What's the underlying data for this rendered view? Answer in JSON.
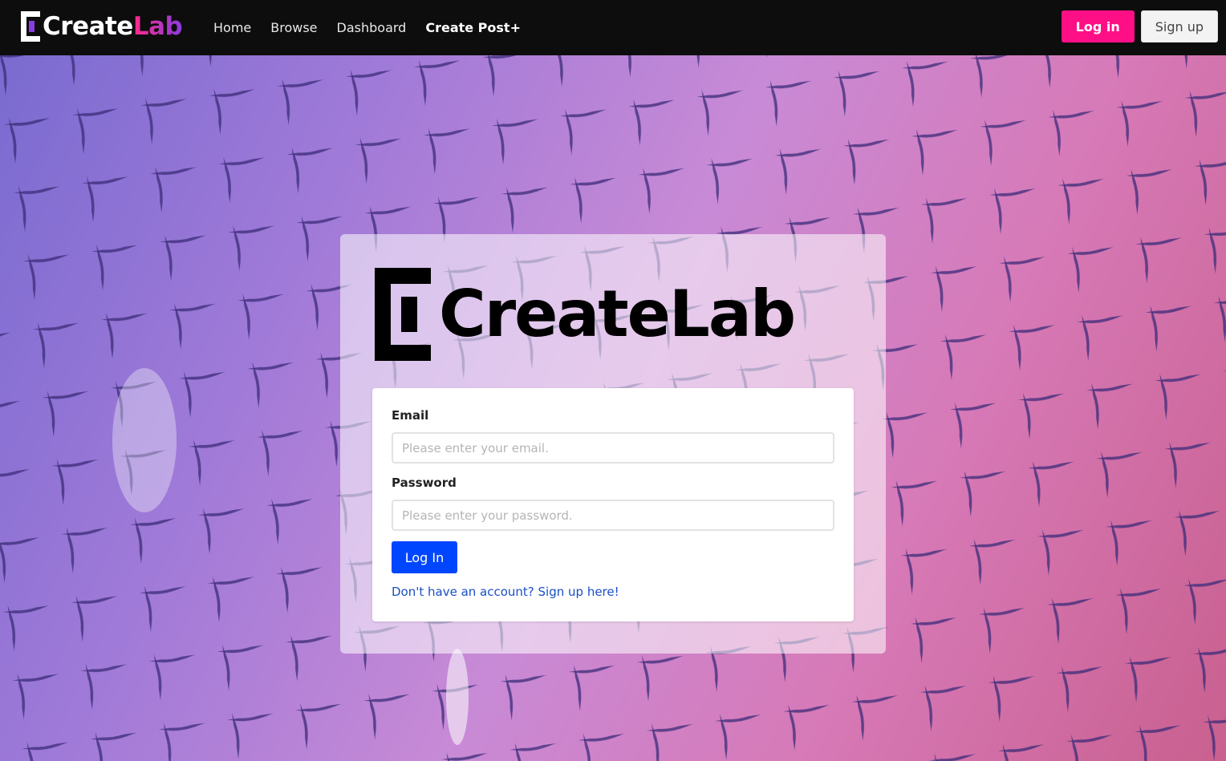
{
  "navbar": {
    "brand_part1": "Create",
    "brand_part2": "Lab",
    "links": [
      "Home",
      "Browse",
      "Dashboard",
      "Create Post+"
    ],
    "login_label": "Log in",
    "signup_label": "Sign up"
  },
  "login_card": {
    "logo_text": "CreateLab",
    "email_label": "Email",
    "email_placeholder": "Please enter your email.",
    "password_label": "Password",
    "password_placeholder": "Please enter your password.",
    "submit_label": "Log In",
    "signup_prompt": "Don't have an account? Sign up here!"
  },
  "colors": {
    "accent_pink": "#ff0f86",
    "primary_blue": "#0046ff",
    "link_blue": "#1b4fc4",
    "navbar_bg": "#0d0d0d"
  }
}
